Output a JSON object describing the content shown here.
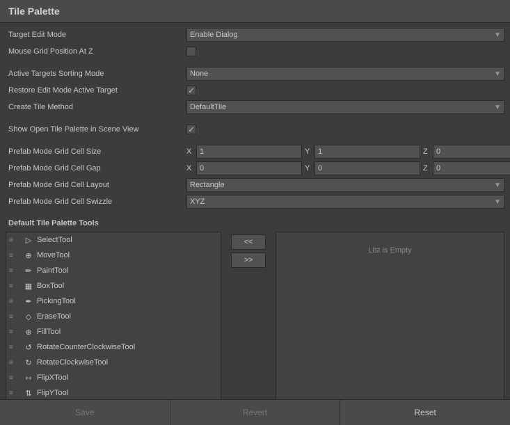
{
  "title": "Tile Palette",
  "fields": {
    "target_edit_mode_label": "Target Edit Mode",
    "target_edit_mode_value": "Enable Dialog",
    "mouse_grid_label": "Mouse Grid Position At Z",
    "mouse_grid_checked": false,
    "active_targets_label": "Active Targets Sorting Mode",
    "active_targets_value": "None",
    "restore_edit_label": "Restore Edit Mode Active Target",
    "restore_edit_checked": true,
    "create_tile_label": "Create Tile Method",
    "create_tile_value": "DefaultTile",
    "show_palette_label": "Show Open Tile Palette in Scene View",
    "show_palette_checked": true,
    "prefab_cell_size_label": "Prefab Mode Grid Cell Size",
    "prefab_cell_size_x": "1",
    "prefab_cell_size_y": "1",
    "prefab_cell_size_z": "0",
    "prefab_cell_gap_label": "Prefab Mode Grid Cell Gap",
    "prefab_cell_gap_x": "0",
    "prefab_cell_gap_y": "0",
    "prefab_cell_gap_z": "0",
    "prefab_cell_layout_label": "Prefab Mode Grid Cell Layout",
    "prefab_cell_layout_value": "Rectangle",
    "prefab_cell_swizzle_label": "Prefab Mode Grid Cell Swizzle",
    "prefab_cell_swizzle_value": "XYZ"
  },
  "tools_section_label": "Default Tile Palette Tools",
  "tools": [
    {
      "name": "SelectTool",
      "icon": "▷"
    },
    {
      "name": "MoveTool",
      "icon": "⊕"
    },
    {
      "name": "PaintTool",
      "icon": "✏"
    },
    {
      "name": "BoxTool",
      "icon": "▦"
    },
    {
      "name": "PickingTool",
      "icon": "✒"
    },
    {
      "name": "EraseTool",
      "icon": "◇"
    },
    {
      "name": "FillTool",
      "icon": "⊕"
    },
    {
      "name": "RotateCounterClockwiseTool",
      "icon": "↺"
    },
    {
      "name": "RotateClockwiseTool",
      "icon": "↻"
    },
    {
      "name": "FlipXTool",
      "icon": "⇿"
    },
    {
      "name": "FlipYTool",
      "icon": "⇅"
    }
  ],
  "buttons": {
    "move_left": "<<",
    "move_right": ">>",
    "empty_list_label": "List is Empty",
    "save": "Save",
    "revert": "Revert",
    "reset": "Reset"
  }
}
